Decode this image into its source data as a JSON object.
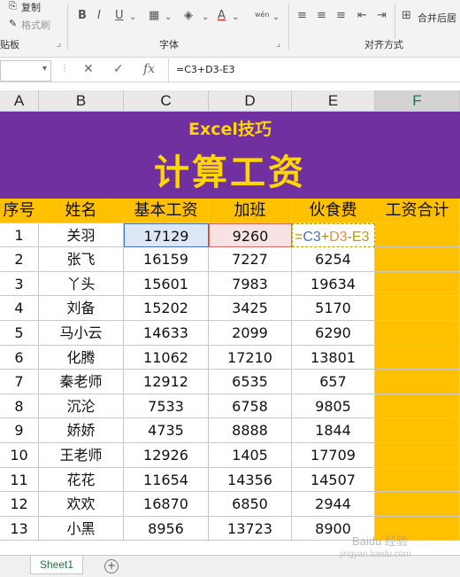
{
  "ribbon": {
    "copy_label": "复制",
    "format_painter_label": "格式刷",
    "clipboard_group": "贴板",
    "font_group": "字体",
    "alignment_group": "对齐方式",
    "merge_label": "合并后居",
    "bold": "B",
    "italic": "I",
    "underline": "U",
    "wen": "wén"
  },
  "formula_bar": {
    "cancel_symbol": "✕",
    "enter_symbol": "✓",
    "fx_symbol": "fx",
    "formula": "=C3+D3-E3"
  },
  "columns": [
    "A",
    "B",
    "C",
    "D",
    "E",
    "F"
  ],
  "banner": {
    "subtitle": "Excel技巧",
    "title": "计算工资"
  },
  "table": {
    "headers": [
      "序号",
      "姓名",
      "基本工资",
      "加班",
      "伙食费",
      "工资合计"
    ],
    "editing_formula": {
      "eq": "=",
      "c": "C3",
      "plus": "+",
      "d": "D3",
      "minus": "-",
      "e": "E3"
    },
    "rows": [
      [
        "1",
        "关羽",
        "17129",
        "9260",
        "",
        ""
      ],
      [
        "2",
        "张飞",
        "16159",
        "7227",
        "6254",
        ""
      ],
      [
        "3",
        "丫头",
        "15601",
        "7983",
        "19634",
        ""
      ],
      [
        "4",
        "刘备",
        "15202",
        "3425",
        "5170",
        ""
      ],
      [
        "5",
        "马小云",
        "14633",
        "2099",
        "6290",
        ""
      ],
      [
        "6",
        "化腾",
        "11062",
        "17210",
        "13801",
        ""
      ],
      [
        "7",
        "秦老师",
        "12912",
        "6535",
        "657",
        ""
      ],
      [
        "8",
        "沉沦",
        "7533",
        "6758",
        "9805",
        ""
      ],
      [
        "9",
        "娇娇",
        "4735",
        "8888",
        "1844",
        ""
      ],
      [
        "10",
        "王老师",
        "12926",
        "1405",
        "17709",
        ""
      ],
      [
        "11",
        "花花",
        "11654",
        "14356",
        "14507",
        ""
      ],
      [
        "12",
        "欢欢",
        "16870",
        "6850",
        "2944",
        ""
      ],
      [
        "13",
        "小黑",
        "8956",
        "13723",
        "8900",
        ""
      ]
    ]
  },
  "sheet_tab": "Sheet1",
  "add_sheet": "+",
  "watermark": {
    "brand": "Baidu 经验",
    "url": "jingyan.baidu.com"
  },
  "colors": {
    "banner_bg": "#7030a0",
    "banner_text": "#ffd700",
    "header_bg": "#ffc000",
    "ref_c": "#4472c4",
    "ref_d": "#e06666",
    "ref_e": "#b8a000"
  }
}
